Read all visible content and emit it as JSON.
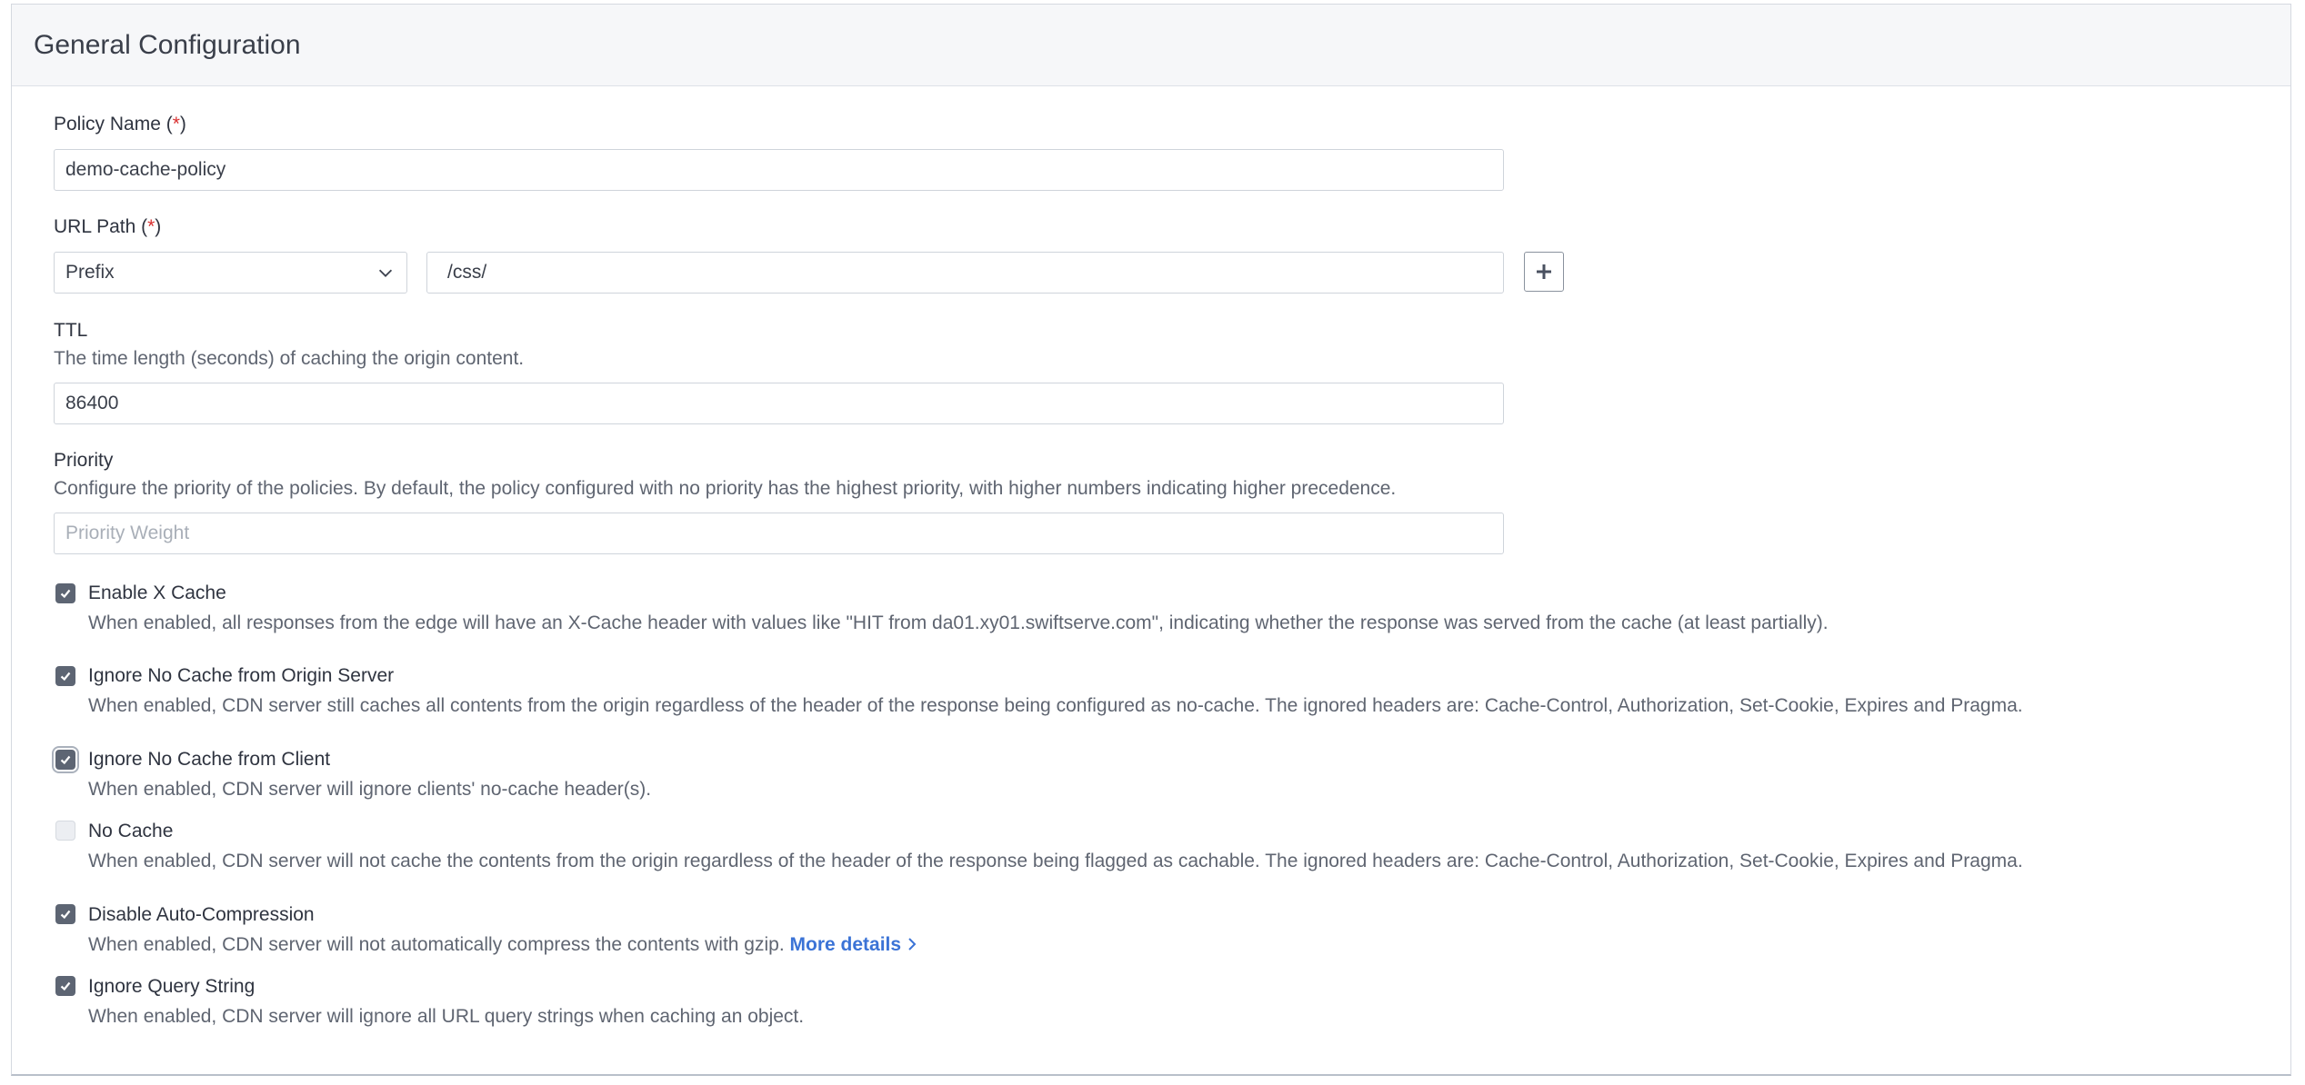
{
  "panel": {
    "title": "General Configuration"
  },
  "policy_name": {
    "label": "Policy Name (",
    "req": "*",
    "close": ")",
    "value": "demo-cache-policy"
  },
  "url_path": {
    "label": "URL Path (",
    "req": "*",
    "close": ")",
    "match_type": "Prefix",
    "value": "/css/"
  },
  "ttl": {
    "label": "TTL",
    "help": "The time length (seconds) of caching the origin content.",
    "value": "86400"
  },
  "priority": {
    "label": "Priority",
    "help": "Configure the priority of the policies. By default, the policy configured with no priority has the highest priority, with higher numbers indicating higher precedence.",
    "placeholder": "Priority Weight"
  },
  "options": [
    {
      "title": "Enable X Cache",
      "checked": true,
      "desc": "When enabled, all responses from the edge will have an X-Cache header with values like \"HIT from da01.xy01.swiftserve.com\", indicating whether the response was served from the cache (at least partially)."
    },
    {
      "title": "Ignore No Cache from Origin Server",
      "checked": true,
      "desc": "When enabled, CDN server still caches all contents from the origin regardless of the header of the response being configured as no-cache. The ignored headers are: Cache-Control, Authorization, Set-Cookie, Expires and Pragma."
    },
    {
      "title": "Ignore No Cache from Client",
      "checked": true,
      "desc": "When enabled, CDN server will ignore clients' no-cache header(s)."
    },
    {
      "title": "No Cache",
      "checked": false,
      "desc": "When enabled, CDN server will not cache the contents from the origin regardless of the header of the response being flagged as cachable. The ignored headers are: Cache-Control, Authorization, Set-Cookie, Expires and Pragma."
    },
    {
      "title": "Disable Auto-Compression",
      "checked": true,
      "desc": "When enabled, CDN server will not automatically compress the contents with gzip.",
      "link": "More details"
    },
    {
      "title": "Ignore Query String",
      "checked": true,
      "desc": "When enabled, CDN server will ignore all URL query strings when caching an object."
    }
  ],
  "icons": {
    "chevron": "chevron-down-icon",
    "plus": "plus-icon",
    "check": "check-icon",
    "link_chevron": "chevron-right-icon"
  },
  "colors": {
    "checkbox": "#5d6573",
    "link": "#3b73d6",
    "required": "#d92f2f"
  }
}
